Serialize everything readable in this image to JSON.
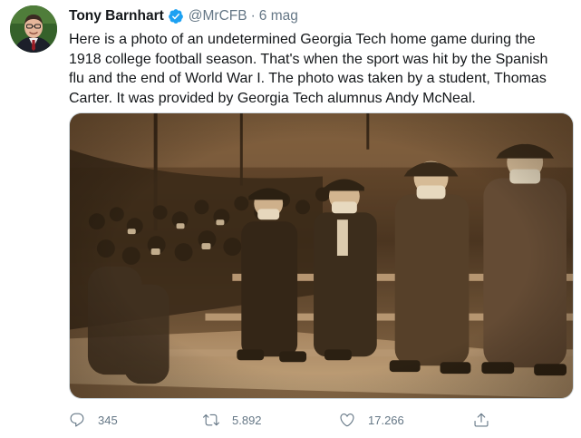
{
  "tweet": {
    "author": {
      "name": "Tony Barnhart",
      "handle": "@MrCFB",
      "verified": true,
      "avatar_icon": "user-avatar"
    },
    "separator": "·",
    "timestamp": "6 mag",
    "text": "Here is a photo of an undetermined Georgia Tech home game during the 1918 college football season. That's when the sport was hit by the Spanish flu and the end of World War I. The photo was taken by a student, Thomas Carter. It was provided by Georgia Tech alumnus Andy McNeal.",
    "media": {
      "type": "photo",
      "tone": "sepia"
    },
    "actions": {
      "reply": {
        "icon": "reply-icon",
        "count": "345"
      },
      "retweet": {
        "icon": "retweet-icon",
        "count": "5.892"
      },
      "like": {
        "icon": "heart-icon",
        "count": "17.266"
      },
      "share": {
        "icon": "share-icon"
      }
    },
    "colors": {
      "text": "#14171a",
      "muted": "#657786",
      "verified": "#1da1f2",
      "border": "#ccd6dd"
    }
  }
}
